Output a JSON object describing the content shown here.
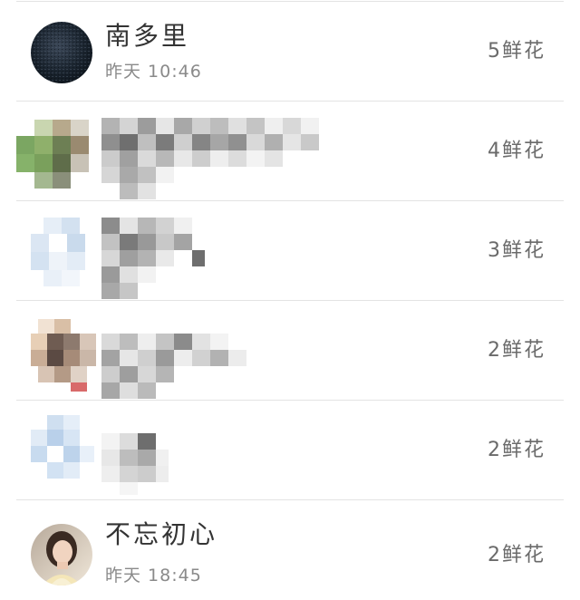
{
  "rows": [
    {
      "name": "南多里",
      "time": "昨天 10:46",
      "flowers": "5鲜花",
      "blurred": false
    },
    {
      "name": "",
      "time": "",
      "flowers": "4鲜花",
      "blurred": true
    },
    {
      "name": "",
      "time": "",
      "flowers": "3鲜花",
      "blurred": true
    },
    {
      "name": "",
      "time": "",
      "flowers": "2鲜花",
      "blurred": true
    },
    {
      "name": "",
      "time": "",
      "flowers": "2鲜花",
      "blurred": true
    },
    {
      "name": "不忘初心",
      "time": "昨天 18:45",
      "flowers": "2鲜花",
      "blurred": false
    }
  ],
  "icons": {
    "row1_avatar": "dark-denim-avatar",
    "row2_avatar": "pixelated-avatar",
    "row3_avatar": "pixelated-avatar",
    "row4_avatar": "pixelated-avatar",
    "row5_avatar": "pixelated-avatar",
    "row6_avatar": "portrait-photo-avatar"
  },
  "colors": {
    "divider": "#e3e3e3",
    "name_text": "#333333",
    "time_text": "#8a8a8a",
    "flowers_text": "#6a6a6a"
  }
}
